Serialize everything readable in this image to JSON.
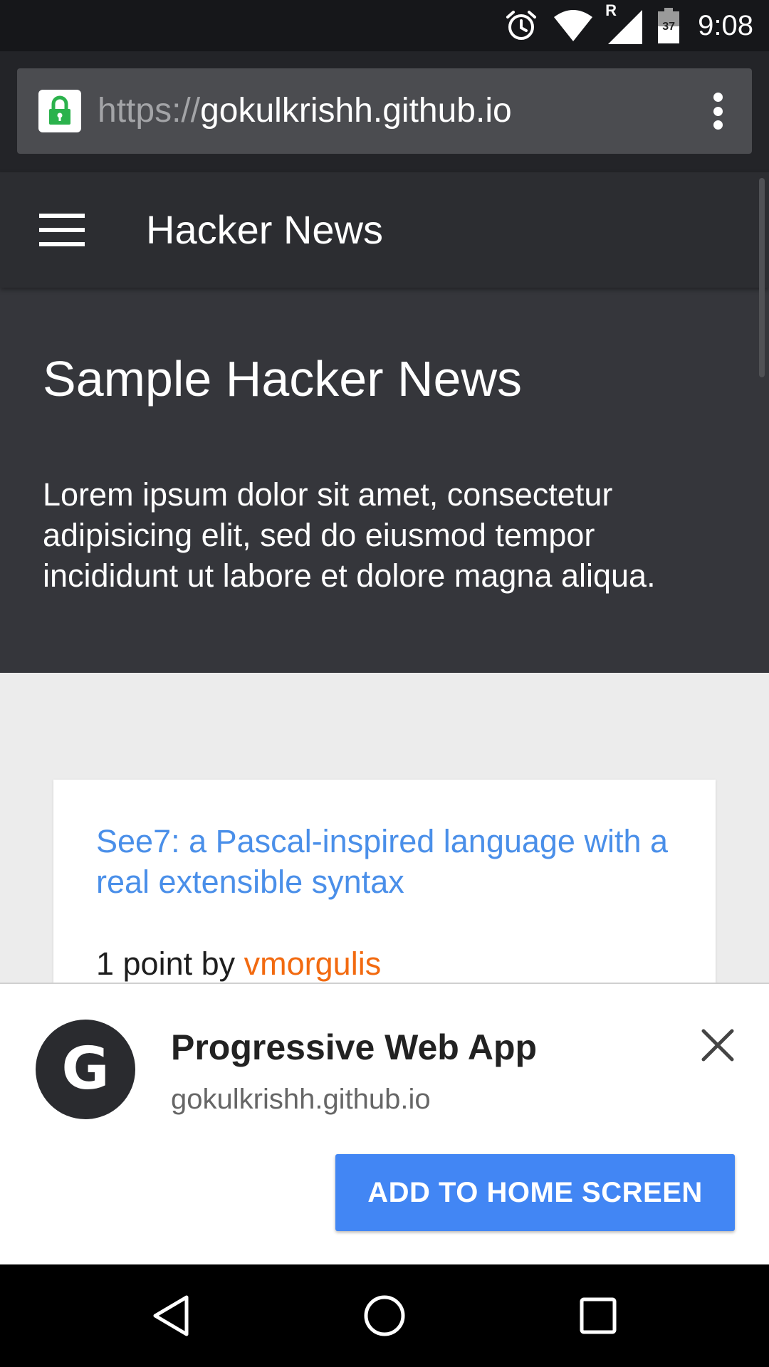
{
  "status_bar": {
    "time": "9:08",
    "battery_level": "37",
    "roaming_indicator": "R",
    "icons": [
      "alarm-icon",
      "wifi-icon",
      "cell-signal-icon",
      "battery-icon"
    ]
  },
  "browser": {
    "url_scheme": "https://",
    "url_host": "gokulkrishh.github.io",
    "secure_color": "#2bb24c",
    "icons": [
      "lock-icon",
      "overflow-menu-icon"
    ]
  },
  "app_bar": {
    "title": "Hacker News",
    "icons": [
      "hamburger-menu-icon"
    ]
  },
  "hero": {
    "title": "Sample Hacker News",
    "description": "Lorem ipsum dolor sit amet, consectetur adipisicing elit, sed do eiusmod tempor incididunt ut labore et dolore magna aliqua."
  },
  "stories": [
    {
      "title": "See7: a Pascal-inspired language with a real extensible syntax",
      "points_text": "1 point by ",
      "author": "vmorgulis"
    }
  ],
  "install_banner": {
    "avatar_letter": "G",
    "app_name": "Progressive Web App",
    "domain": "gokulkrishh.github.io",
    "button_label": "ADD TO HOME SCREEN",
    "button_color": "#4286f4",
    "icons": [
      "close-icon"
    ]
  },
  "nav_bar": {
    "icons": [
      "back-icon",
      "home-icon",
      "recents-icon"
    ]
  }
}
